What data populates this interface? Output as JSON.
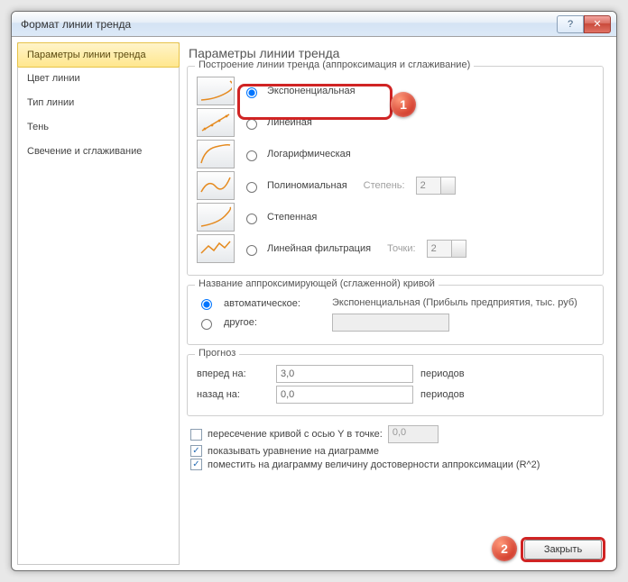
{
  "window": {
    "title": "Формат линии тренда",
    "help": "?",
    "close": "✕"
  },
  "nav": {
    "items": [
      {
        "label": "Параметры линии тренда",
        "selected": true
      },
      {
        "label": "Цвет линии",
        "selected": false
      },
      {
        "label": "Тип линии",
        "selected": false
      },
      {
        "label": "Тень",
        "selected": false
      },
      {
        "label": "Свечение и сглаживание",
        "selected": false
      }
    ]
  },
  "content": {
    "heading": "Параметры линии тренда",
    "build_group": {
      "label": "Построение линии тренда (аппроксимация и сглаживание)",
      "options": [
        {
          "id": "exp",
          "label": "Экспоненциальная",
          "checked": true
        },
        {
          "id": "lin",
          "label": "Линейная"
        },
        {
          "id": "log",
          "label": "Логарифмическая"
        },
        {
          "id": "poly",
          "label": "Полиномиальная",
          "param_label": "Степень:",
          "param_value": "2",
          "param_disabled": true
        },
        {
          "id": "pow",
          "label": "Степенная"
        },
        {
          "id": "mavg",
          "label": "Линейная фильтрация",
          "param_label": "Точки:",
          "param_value": "2",
          "param_disabled": true
        }
      ]
    },
    "name_group": {
      "label": "Название аппроксимирующей (сглаженной) кривой",
      "auto_label": "автоматическое:",
      "auto_value": "Экспоненциальная (Прибыль предприятия, тыс. руб)",
      "auto_checked": true,
      "other_label": "другое:",
      "other_value": ""
    },
    "forecast_group": {
      "label": "Прогноз",
      "forward_label": "вперед на:",
      "forward_value": "3,0",
      "backward_label": "назад на:",
      "backward_value": "0,0",
      "unit": "периодов"
    },
    "checks": {
      "intercept_label": "пересечение кривой с осью Y в точке:",
      "intercept_value": "0,0",
      "intercept_checked": false,
      "equation_label": "показывать уравнение на диаграмме",
      "equation_checked": true,
      "r2_label": "поместить на диаграмму величину достоверности аппроксимации (R^2)",
      "r2_checked": true
    },
    "close_btn": "Закрыть"
  },
  "callouts": {
    "b1": "1",
    "b2": "2"
  }
}
